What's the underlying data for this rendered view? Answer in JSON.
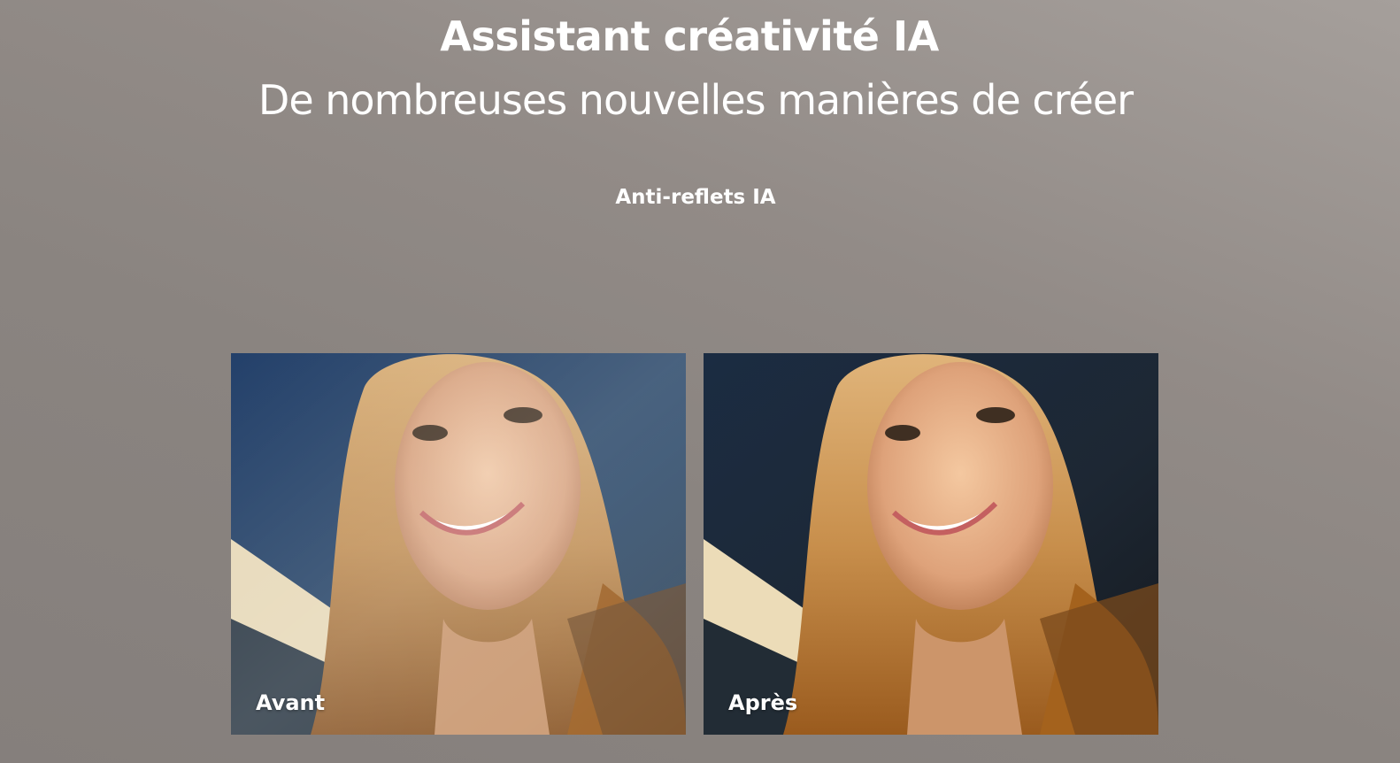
{
  "hero": {
    "title": "Assistant créativité IA",
    "subtitle": "De nombreuses nouvelles manières de créer"
  },
  "feature": {
    "active_tab": "Anti-reflets IA"
  },
  "comparison": {
    "before_label": "Avant",
    "after_label": "Après"
  },
  "colors": {
    "text": "#ffffff",
    "background_top": "#a59f9b",
    "background_bottom": "#857f7c",
    "sky_before": "#2b4566",
    "sky_after": "#1f2b3b",
    "hair": "#c79a5f",
    "skin": "#e2b494"
  },
  "icons": {
    "portrait": "portrait-photo"
  }
}
